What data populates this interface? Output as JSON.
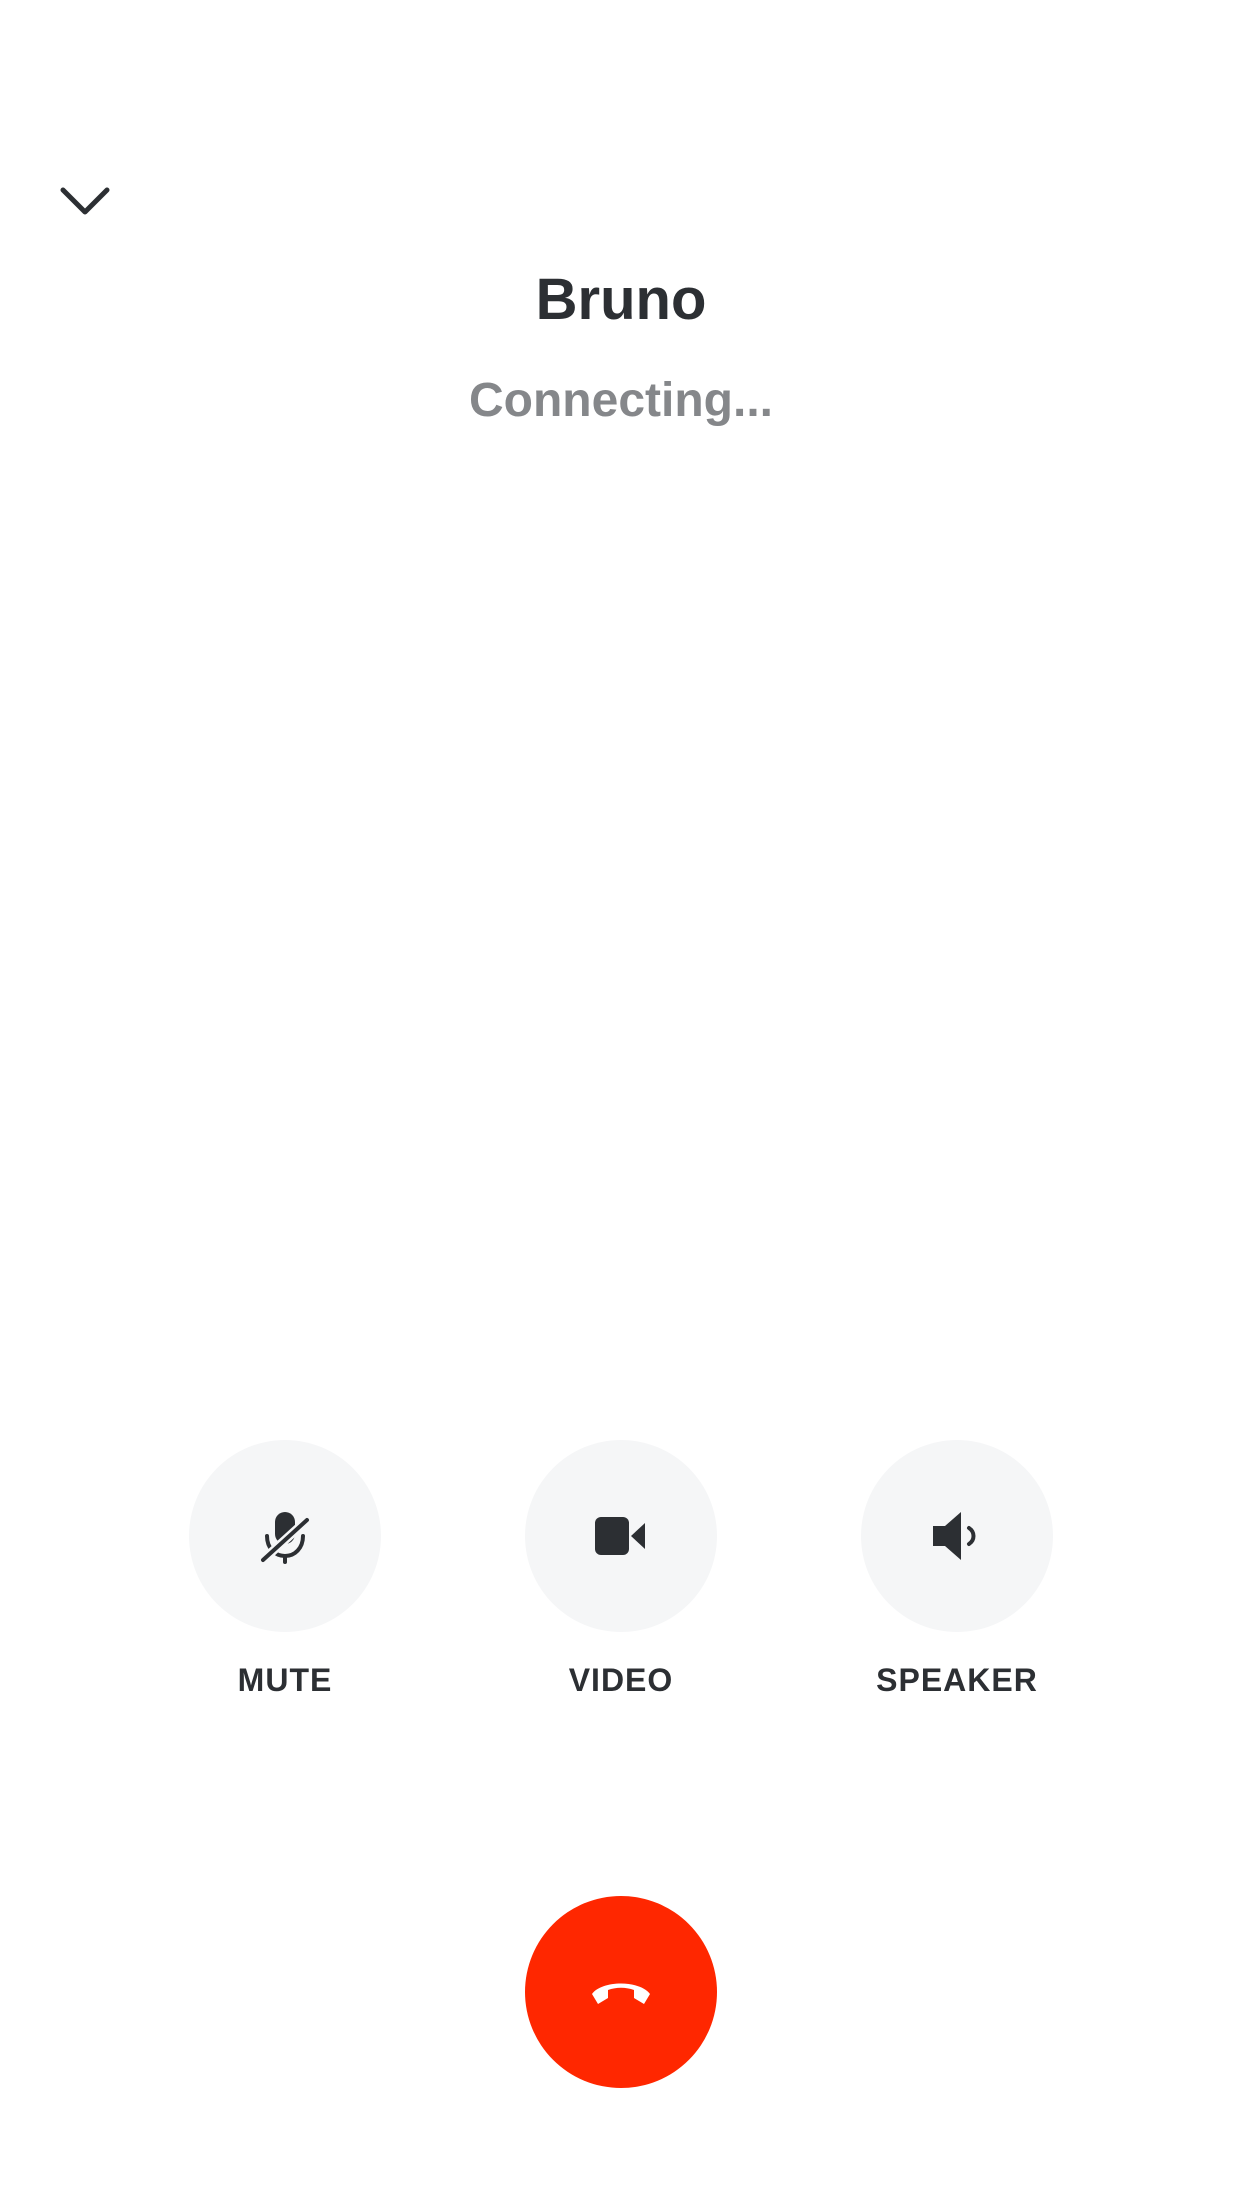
{
  "call": {
    "caller_name": "Bruno",
    "status": "Connecting..."
  },
  "controls": [
    {
      "label": "MUTE",
      "icon": "mic-off-icon"
    },
    {
      "label": "VIDEO",
      "icon": "video-camera-icon"
    },
    {
      "label": "SPEAKER",
      "icon": "speaker-icon"
    }
  ],
  "header": {
    "collapse_icon": "chevron-down-icon"
  },
  "end_call": {
    "icon": "hang-up-icon",
    "color": "#ff2700"
  },
  "colors": {
    "text_primary": "#2c2f33",
    "text_secondary": "#85878a",
    "control_background": "#f5f6f7",
    "end_call": "#ff2700",
    "background": "#ffffff"
  }
}
